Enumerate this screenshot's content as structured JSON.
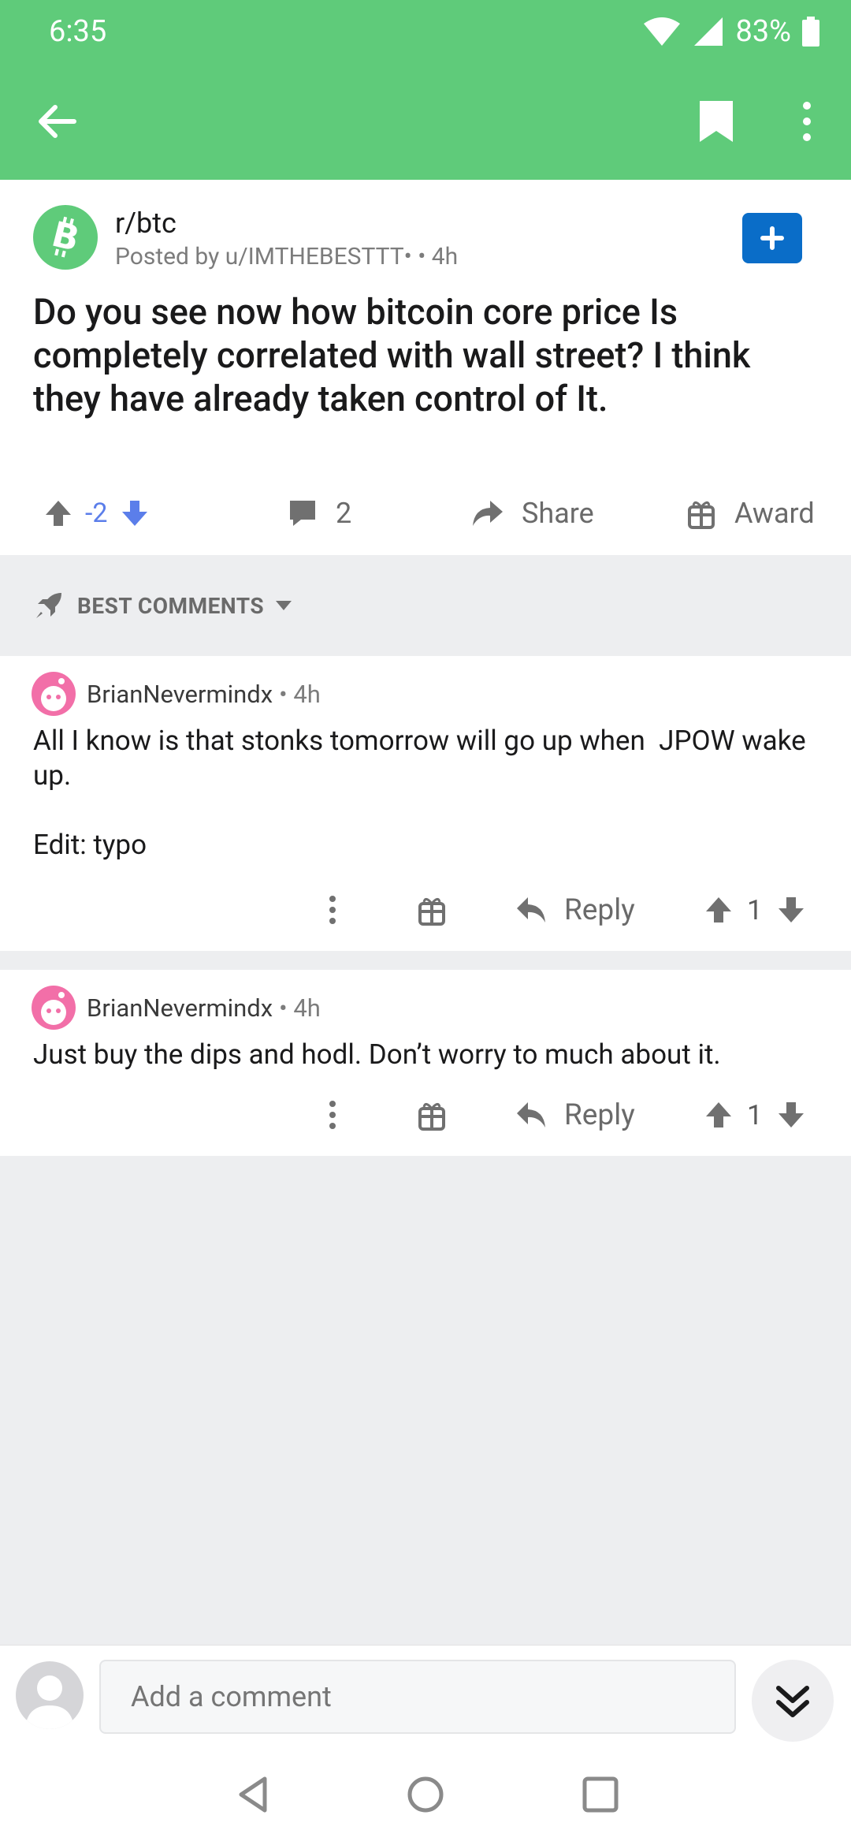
{
  "status": {
    "time": "6:35",
    "battery": "83%"
  },
  "post": {
    "subreddit": "r/btc",
    "posted_by": "Posted by u/IMTHEBESTTT•  • 4h",
    "title": "Do you see now how bitcoin core price Is completely correlated with wall street? I think they have already taken control of It.",
    "vote_count": "-2",
    "comment_count": "2",
    "share_label": "Share",
    "award_label": "Award"
  },
  "sort": {
    "label": "BEST COMMENTS"
  },
  "comments": [
    {
      "author": "BrianNevermindx",
      "age": "• 4h",
      "body": "All I know is that stonks tomorrow will go up when  JPOW wake up.\n\nEdit: typo",
      "reply_label": "Reply",
      "score": "1"
    },
    {
      "author": "BrianNevermindx",
      "age": "• 4h",
      "body": "Just buy the dips and hodl. Don’t worry to much about it.",
      "reply_label": "Reply",
      "score": "1"
    }
  ],
  "composer": {
    "placeholder": "Add a comment"
  },
  "colors": {
    "app_green": "#5FCB7A",
    "join_blue": "#0A6DC8",
    "vote_blue": "#5B7EEA"
  },
  "icons": [
    "back-arrow-icon",
    "bookmark-icon",
    "more-vert-icon",
    "bitcoin-icon",
    "plus-icon",
    "upvote-icon",
    "downvote-icon",
    "comment-icon",
    "share-icon",
    "gift-icon",
    "rocket-icon",
    "chevron-down-icon",
    "reply-icon",
    "double-chevron-down-icon"
  ]
}
